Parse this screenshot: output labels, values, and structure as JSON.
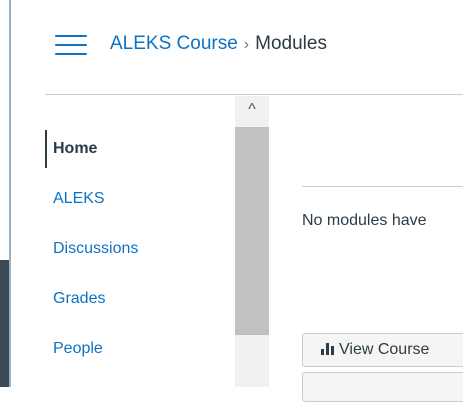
{
  "breadcrumb": {
    "course": "ALEKS Course",
    "separator": "›",
    "current": "Modules"
  },
  "nav": {
    "items": [
      {
        "label": "Home",
        "active": true
      },
      {
        "label": "ALEKS",
        "active": false
      },
      {
        "label": "Discussions",
        "active": false
      },
      {
        "label": "Grades",
        "active": false
      },
      {
        "label": "People",
        "active": false
      }
    ]
  },
  "scrollbar": {
    "up_arrow": "^"
  },
  "content": {
    "empty_message": "No modules have",
    "view_course_label": "View Course"
  },
  "colors": {
    "link": "#0e72c4",
    "text": "#2d3b45"
  }
}
